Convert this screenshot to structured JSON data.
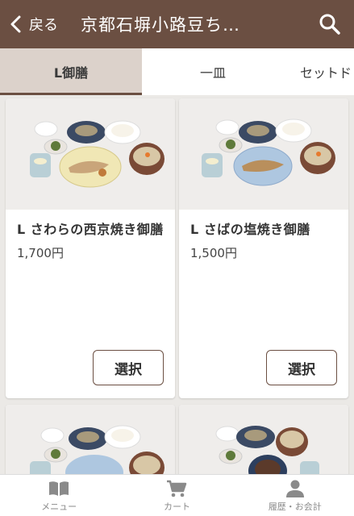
{
  "header": {
    "back_label": "戻る",
    "title": "京都石塀小路豆ち…"
  },
  "tabs": [
    {
      "label": "L御膳"
    },
    {
      "label": "一皿"
    },
    {
      "label": "セットド"
    }
  ],
  "menu_items": [
    {
      "name": "L さわらの西京焼き御膳",
      "price": "1,700円",
      "button": "選択"
    },
    {
      "name": "L さばの塩焼き御膳",
      "price": "1,500円",
      "button": "選択"
    }
  ],
  "bottom_nav": [
    {
      "label": "メニュー",
      "icon": "book-icon"
    },
    {
      "label": "カート",
      "icon": "cart-icon"
    },
    {
      "label": "履歴・お会計",
      "icon": "person-icon"
    }
  ],
  "colors": {
    "header_bg": "#6b4f42",
    "active_tab_bg": "#dcd2cb",
    "page_bg": "#ebe9e6"
  }
}
